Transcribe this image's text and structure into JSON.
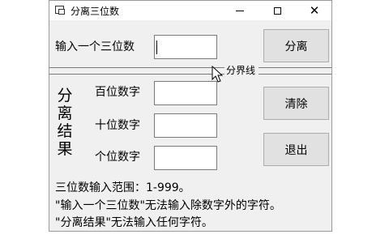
{
  "window": {
    "title": "分离三位数",
    "controls": {
      "minimize": "minimize",
      "maximize": "maximize",
      "close": "✕"
    }
  },
  "input": {
    "label": "输入一个三位数",
    "value": ""
  },
  "buttons": {
    "split": "分离",
    "clear": "清除",
    "exit": "退出"
  },
  "divider": {
    "label": "分界线"
  },
  "result": {
    "group_title": [
      "分",
      "离",
      "结",
      "果"
    ],
    "hundreds_label": "百位数字",
    "tens_label": "十位数字",
    "ones_label": "个位数字",
    "hundreds_value": "",
    "tens_value": "",
    "ones_value": ""
  },
  "info": {
    "line1": "三位数输入范围：1-999。",
    "line2": "\"输入一个三位数\"无法输入除数字外的字符。",
    "line3": "\"分离结果\"无法输入任何字符。"
  },
  "icons": {
    "app": "app-window-icon",
    "cursor": "mouse-pointer-icon"
  }
}
